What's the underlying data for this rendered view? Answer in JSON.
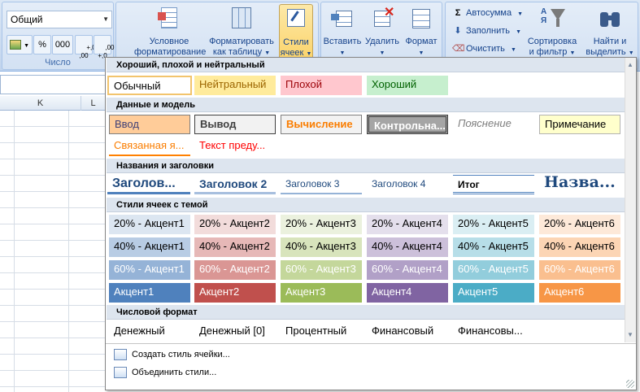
{
  "ribbon": {
    "number_format_value": "Общий",
    "number_group_label": "Число",
    "percent_label": "%",
    "thousands_label": "000",
    "inc_decimal_label": "+,0\n,00",
    "dec_decimal_label": ",00\n+,0",
    "conditional_formatting": "Условное\nформатирование",
    "format_as_table": "Форматировать\nкак таблицу",
    "cell_styles": "Стили\nячеек",
    "insert": "Вставить",
    "delete": "Удалить",
    "format": "Формат",
    "autosum": "Автосумма",
    "fill": "Заполнить",
    "clear": "Очистить",
    "sort_filter": "Сортировка\nи фильтр",
    "find_select": "Найти и\nвыделить"
  },
  "sheet": {
    "col_k": "K",
    "col_l": "L"
  },
  "gallery": {
    "sections": {
      "good_bad": "Хороший, плохой и нейтральный",
      "data_model": "Данные и модель",
      "titles": "Названия и заголовки",
      "themed": "Стили ячеек с темой",
      "number": "Числовой формат"
    },
    "good_bad": [
      "Обычный",
      "Нейтральный",
      "Плохой",
      "Хороший"
    ],
    "data_model_row1": [
      "Ввод",
      "Вывод",
      "Вычисление",
      "Контрольна...",
      "Пояснение",
      "Примечание"
    ],
    "data_model_row2": [
      "Связанная я...",
      "Текст преду..."
    ],
    "titles": [
      "Заголов...",
      "Заголовок 2",
      "Заголовок 3",
      "Заголовок 4",
      "Итог",
      "Назва..."
    ],
    "accent20": [
      "20% - Акцент1",
      "20% - Акцент2",
      "20% - Акцент3",
      "20% - Акцент4",
      "20% - Акцент5",
      "20% - Акцент6"
    ],
    "accent40": [
      "40% - Акцент1",
      "40% - Акцент2",
      "40% - Акцент3",
      "40% - Акцент4",
      "40% - Акцент5",
      "40% - Акцент6"
    ],
    "accent60": [
      "60% - Акцент1",
      "60% - Акцент2",
      "60% - Акцент3",
      "60% - Акцент4",
      "60% - Акцент5",
      "60% - Акцент6"
    ],
    "accent": [
      "Акцент1",
      "Акцент2",
      "Акцент3",
      "Акцент4",
      "Акцент5",
      "Акцент6"
    ],
    "number": [
      "Денежный",
      "Денежный [0]",
      "Процентный",
      "Финансовый",
      "Финансовы..."
    ],
    "new_style": "Создать стиль ячейки...",
    "merge_styles": "Объединить стили..."
  },
  "colors": {
    "accent1": "#4f81bd",
    "accent2": "#c0504d",
    "accent3": "#9bbb59",
    "accent4": "#8064a2",
    "accent5": "#4bacc6",
    "accent6": "#f79646"
  }
}
